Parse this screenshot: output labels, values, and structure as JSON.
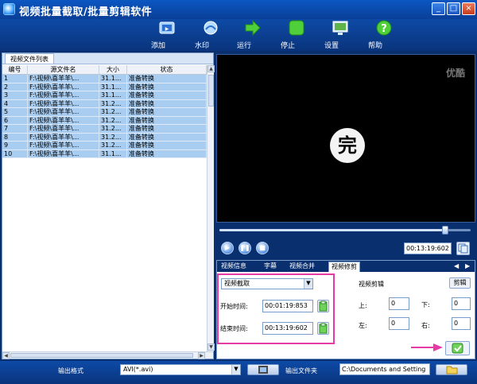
{
  "window": {
    "title": "视频批量截取/批量剪辑软件",
    "minimize": "_",
    "maximize": "□",
    "close": "×"
  },
  "toolbar": {
    "add": "添加",
    "watermark": "水印",
    "run": "运行",
    "stop": "停止",
    "settings": "设置",
    "help": "帮助"
  },
  "file_list": {
    "tab": "视频文件列表",
    "columns": [
      "编号",
      "源文件名",
      "大小",
      "状态"
    ],
    "rows": [
      {
        "no": "1",
        "name": "F:\\视频\\喜羊羊\\...",
        "size": "31.1...",
        "status": "准备转换"
      },
      {
        "no": "2",
        "name": "F:\\视频\\喜羊羊\\...",
        "size": "31.1...",
        "status": "准备转换"
      },
      {
        "no": "3",
        "name": "F:\\视频\\喜羊羊\\...",
        "size": "31.1...",
        "status": "准备转换"
      },
      {
        "no": "4",
        "name": "F:\\视频\\喜羊羊\\...",
        "size": "31.2...",
        "status": "准备转换"
      },
      {
        "no": "5",
        "name": "F:\\视频\\喜羊羊\\...",
        "size": "31.2...",
        "status": "准备转换"
      },
      {
        "no": "6",
        "name": "F:\\视频\\喜羊羊\\...",
        "size": "31.2...",
        "status": "准备转换"
      },
      {
        "no": "7",
        "name": "F:\\视频\\喜羊羊\\...",
        "size": "31.2...",
        "status": "准备转换"
      },
      {
        "no": "8",
        "name": "F:\\视频\\喜羊羊\\...",
        "size": "31.2...",
        "status": "准备转换"
      },
      {
        "no": "9",
        "name": "F:\\视频\\喜羊羊\\...",
        "size": "31.2...",
        "status": "准备转换"
      },
      {
        "no": "10",
        "name": "F:\\视频\\喜羊羊\\...",
        "size": "31.1...",
        "status": "准备转换"
      }
    ]
  },
  "preview": {
    "watermark": "优酷",
    "end_char": "完",
    "progress_fraction": 0.9
  },
  "playback": {
    "time": "00:13:19:602"
  },
  "tabs": [
    "视频信息",
    "字幕",
    "视频合并",
    "视频修剪"
  ],
  "tab_arrows": {
    "left": "◀",
    "right": "▶"
  },
  "trim": {
    "mode": "视频截取",
    "start_label": "开始时间:",
    "start_time": "00:01:19:853",
    "end_label": "结束时间:",
    "end_time": "00:13:19:602"
  },
  "crop": {
    "title": "视频剪辑",
    "button": "剪辑",
    "top_label": "上:",
    "top": "0",
    "bottom_label": "下:",
    "bottom": "0",
    "left_label": "左:",
    "left": "0",
    "right_label": "右:",
    "right": "0"
  },
  "status": {
    "format_label": "输出格式",
    "format_value": "AVI(*.avi)",
    "folder_label": "输出文件夹",
    "folder_value": "C:\\Documents and Setting"
  }
}
